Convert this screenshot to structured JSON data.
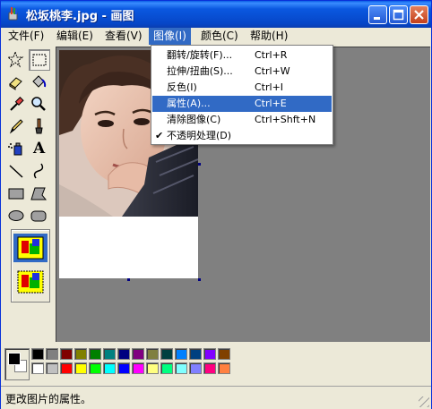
{
  "window": {
    "title": "松坂桃李.jpg - 画图",
    "app_icon": "paint-brush-cup-icon"
  },
  "title_buttons": {
    "minimize": "minimize-icon",
    "maximize": "maximize-icon",
    "close": "close-icon"
  },
  "menubar": {
    "items": [
      {
        "label": "文件(F)"
      },
      {
        "label": "编辑(E)"
      },
      {
        "label": "查看(V)"
      },
      {
        "label": "图像(I)"
      },
      {
        "label": "颜色(C)"
      },
      {
        "label": "帮助(H)"
      }
    ],
    "active_index": 3
  },
  "image_menu": {
    "items": [
      {
        "label": "翻转/旋转(F)...",
        "shortcut": "Ctrl+R",
        "checked": false,
        "highlighted": false
      },
      {
        "label": "拉伸/扭曲(S)...",
        "shortcut": "Ctrl+W",
        "checked": false,
        "highlighted": false
      },
      {
        "label": "反色(I)",
        "shortcut": "Ctrl+I",
        "checked": false,
        "highlighted": false
      },
      {
        "label": "属性(A)...",
        "shortcut": "Ctrl+E",
        "checked": false,
        "highlighted": true
      },
      {
        "label": "清除图像(C)",
        "shortcut": "Ctrl+Shft+N",
        "checked": false,
        "highlighted": false
      },
      {
        "label": "不透明处理(D)",
        "shortcut": "",
        "checked": true,
        "highlighted": false
      }
    ],
    "check_mark": "✔"
  },
  "toolbox": {
    "tools": [
      "free-form-select-icon",
      "rectangle-select-icon",
      "eraser-icon",
      "fill-bucket-icon",
      "color-picker-icon",
      "magnifier-icon",
      "pencil-icon",
      "brush-icon",
      "airbrush-icon",
      "text-tool-icon",
      "line-tool-icon",
      "curve-tool-icon",
      "rectangle-tool-icon",
      "polygon-tool-icon",
      "ellipse-tool-icon",
      "rounded-rectangle-tool-icon"
    ],
    "selected": "rectangle-select-icon",
    "text_tool_glyph": "A",
    "options": [
      "opaque-selection-icon",
      "transparent-selection-icon"
    ]
  },
  "palette": {
    "foreground": "#000000",
    "background": "#ffffff",
    "row1": [
      "#000000",
      "#808080",
      "#800000",
      "#808000",
      "#008000",
      "#008080",
      "#000080",
      "#800080",
      "#808040",
      "#004040",
      "#0080ff",
      "#004080",
      "#8000ff",
      "#804000"
    ],
    "row2": [
      "#ffffff",
      "#c0c0c0",
      "#ff0000",
      "#ffff00",
      "#00ff00",
      "#00ffff",
      "#0000ff",
      "#ff00ff",
      "#ffff80",
      "#00ff80",
      "#80ffff",
      "#8080ff",
      "#ff0080",
      "#ff8040"
    ]
  },
  "canvas": {
    "background": "#808080",
    "image_name": "portrait-photo"
  },
  "statusbar": {
    "text": "更改图片的属性。"
  }
}
